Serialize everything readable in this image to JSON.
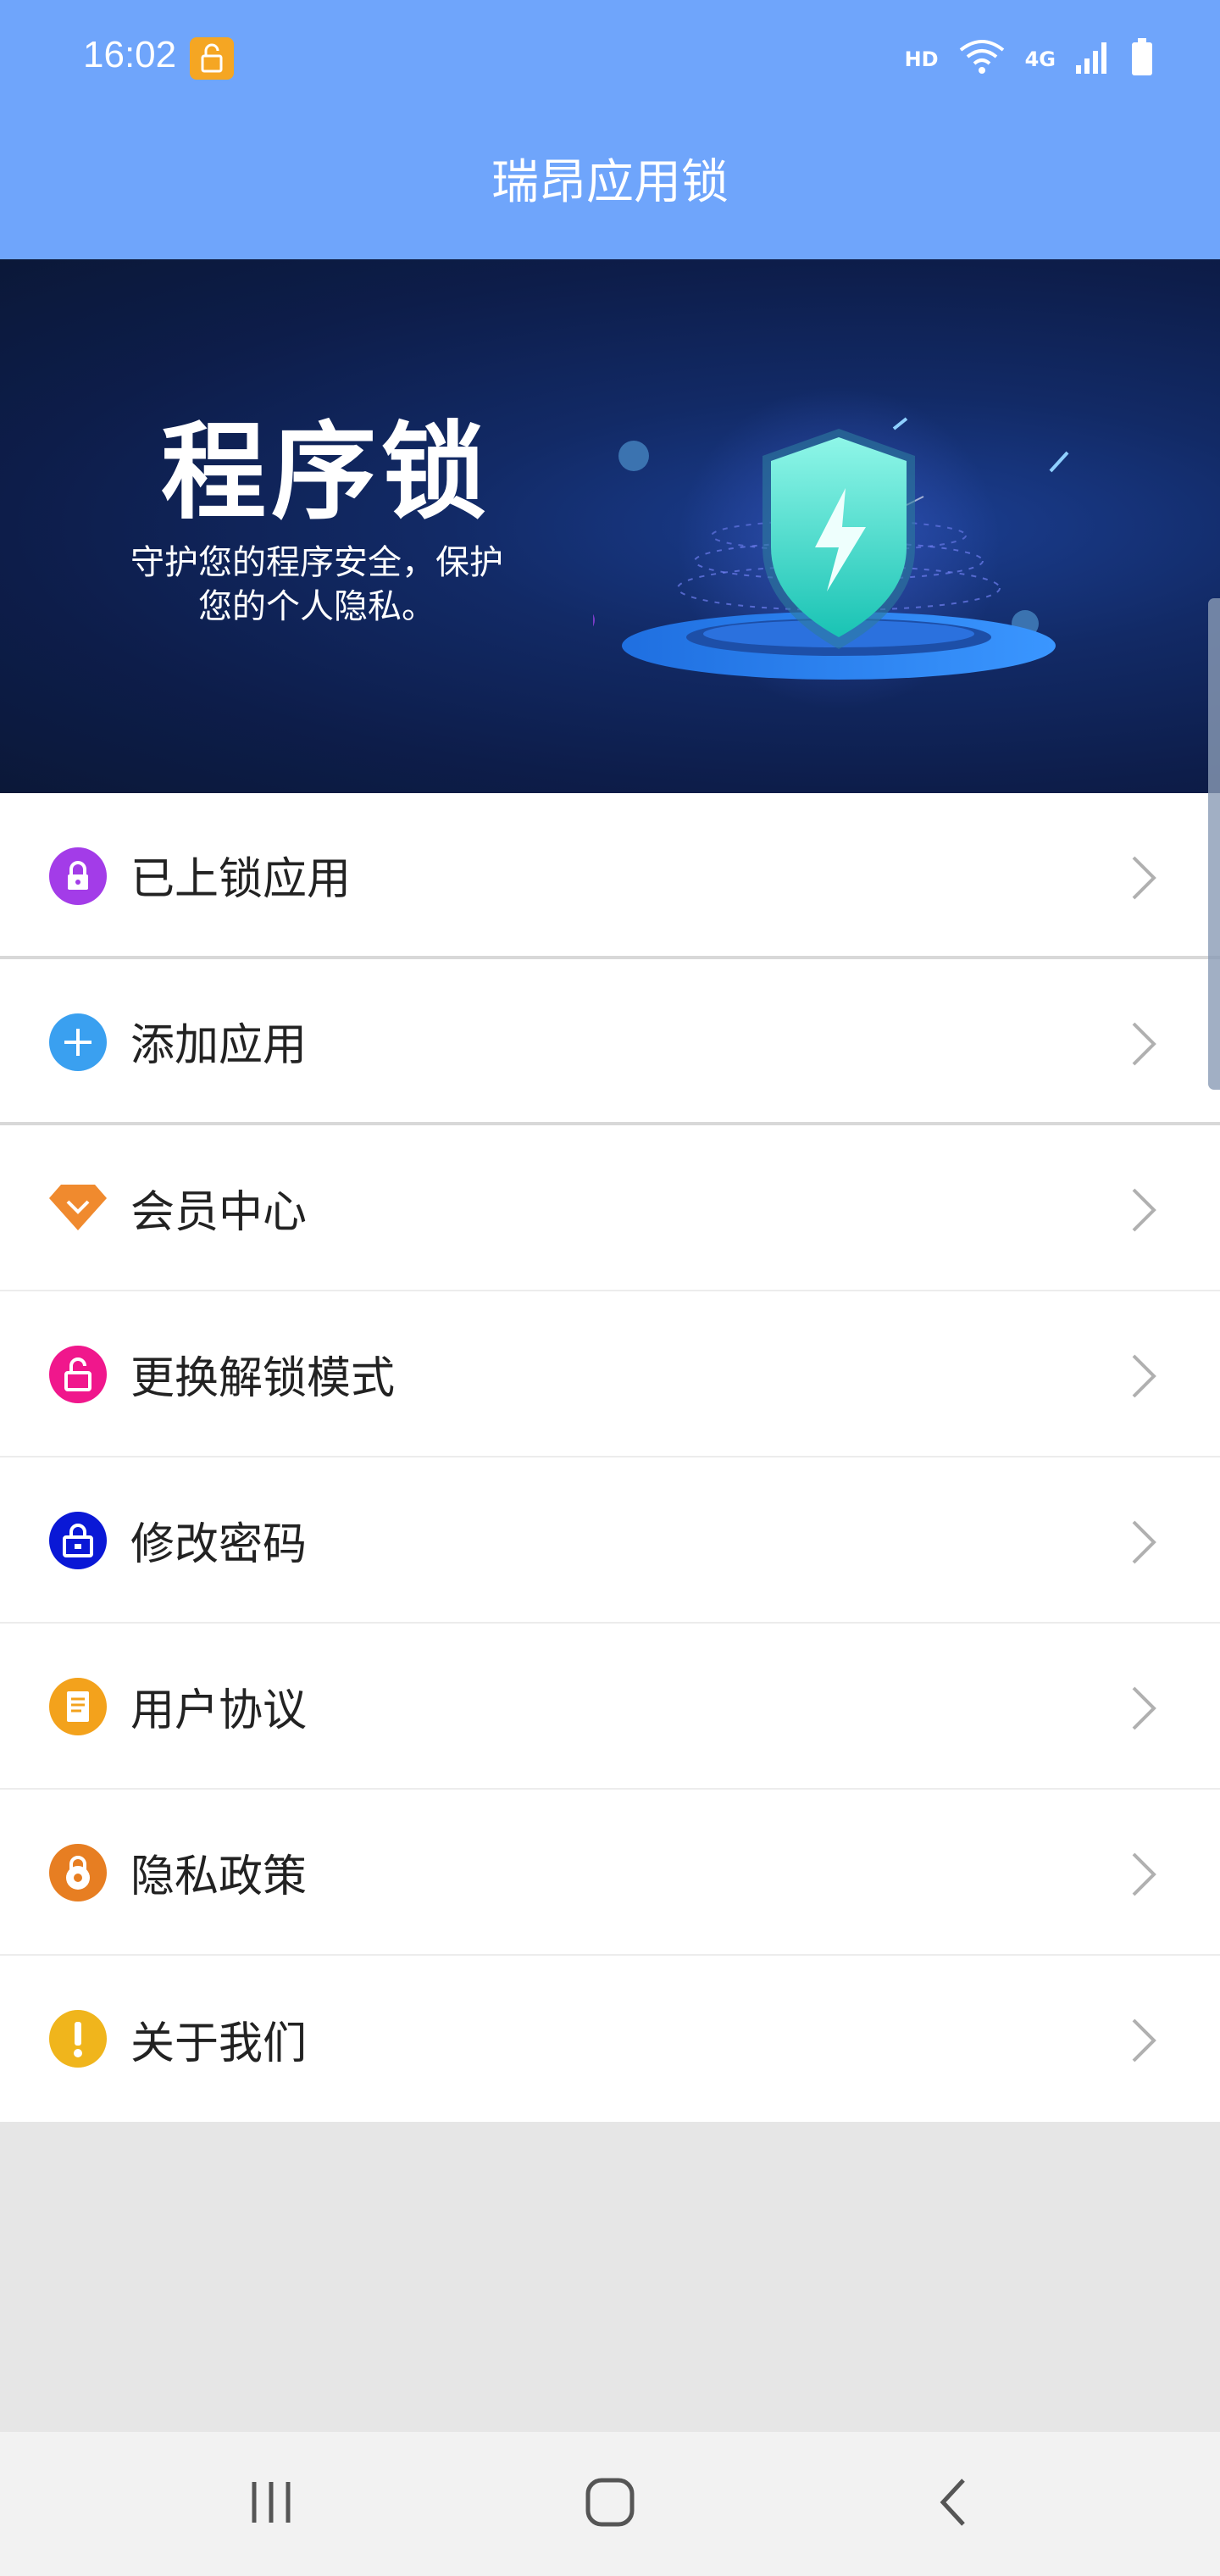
{
  "status_bar": {
    "time": "16:02",
    "indicators": [
      "HD",
      "wifi-icon",
      "4G",
      "signal-icon",
      "battery-icon"
    ],
    "hd_label": "HD",
    "network_label": "4G"
  },
  "header": {
    "title": "瑞昂应用锁",
    "background": "#6fa5fb"
  },
  "banner": {
    "headline": "程序锁",
    "subtitle_line1": "守护您的程序安全，保护",
    "subtitle_line2": "您的个人隐私。"
  },
  "menu": {
    "items": [
      {
        "label": "已上锁应用",
        "icon": "lock-icon",
        "color": "#a33ce8"
      },
      {
        "label": "添加应用",
        "icon": "plus-icon",
        "color": "#3aa0f0"
      },
      {
        "label": "会员中心",
        "icon": "diamond-icon",
        "color": "#f08a2e"
      },
      {
        "label": "更换解锁模式",
        "icon": "unlock-icon",
        "color": "#f0178c"
      },
      {
        "label": "修改密码",
        "icon": "password-lock-icon",
        "color": "#0a18d6"
      },
      {
        "label": "用户协议",
        "icon": "document-icon",
        "color": "#f3a21c"
      },
      {
        "label": "隐私政策",
        "icon": "privacy-lock-icon",
        "color": "#e77e22"
      },
      {
        "label": "关于我们",
        "icon": "exclamation-icon",
        "color": "#f0b51c"
      }
    ]
  },
  "nav_bar": {
    "buttons": [
      "recents-icon",
      "home-icon",
      "back-icon"
    ]
  }
}
